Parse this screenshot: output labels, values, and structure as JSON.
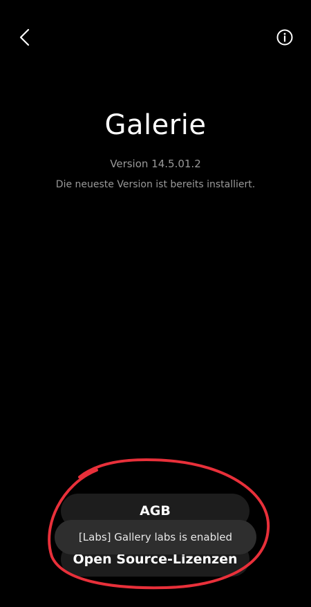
{
  "header": {
    "back_icon": "chevron-left-icon",
    "info_icon": "info-circle-icon"
  },
  "app": {
    "title": "Galerie",
    "version": "Version 14.5.01.2",
    "status": "Die neueste Version ist bereits installiert."
  },
  "buttons": {
    "agb_label": "AGB",
    "open_source_label": "Open Source-Lizenzen"
  },
  "toast": {
    "message": "[Labs] Gallery labs is enabled"
  },
  "colors": {
    "background": "#000000",
    "text_secondary": "#9a9a9a",
    "button_bg": "#1d1d1d",
    "toast_bg": "#2e2e2e",
    "annotation": "#e8303a"
  }
}
